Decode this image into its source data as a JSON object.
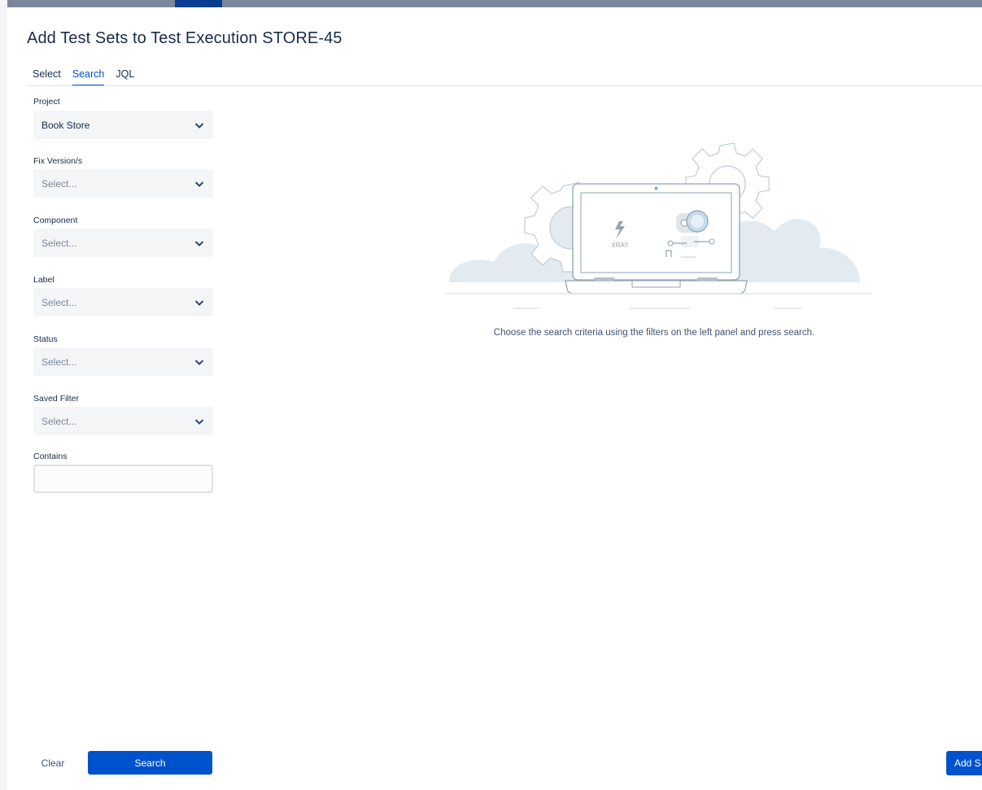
{
  "dialog": {
    "title": "Add Test Sets to Test Execution STORE-45"
  },
  "tabs": [
    {
      "label": "Select",
      "active": false
    },
    {
      "label": "Search",
      "active": true
    },
    {
      "label": "JQL",
      "active": false
    }
  ],
  "filters": {
    "project": {
      "label": "Project",
      "value": "Book Store"
    },
    "fix_version": {
      "label": "Fix Version/s",
      "placeholder": "Select..."
    },
    "component": {
      "label": "Component",
      "placeholder": "Select..."
    },
    "label": {
      "label": "Label",
      "placeholder": "Select..."
    },
    "status": {
      "label": "Status",
      "placeholder": "Select..."
    },
    "saved_filter": {
      "label": "Saved Filter",
      "placeholder": "Select..."
    },
    "contains": {
      "label": "Contains",
      "value": ""
    }
  },
  "empty_state": {
    "illustration_logo_text": "XRAY",
    "message": "Choose the search criteria using the filters on the left panel and press search."
  },
  "footer": {
    "clear_label": "Clear",
    "search_label": "Search",
    "add_label": "Add S"
  },
  "colors": {
    "accent": "#0052cc",
    "text": "#172b4d",
    "field_bg": "#f4f5f7"
  }
}
